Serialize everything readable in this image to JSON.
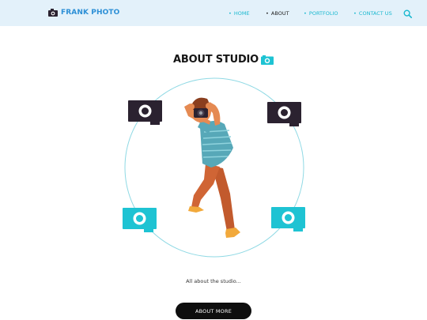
{
  "brand": {
    "name": "FRANK PHOTO",
    "icon": "camera-icon",
    "color": "#2c8fd6"
  },
  "nav": {
    "items": [
      {
        "label": "HOME",
        "active": false
      },
      {
        "label": "ABOUT",
        "active": true
      },
      {
        "label": "PORTFOLIO",
        "active": false
      },
      {
        "label": "CONTACT US",
        "active": false
      }
    ],
    "bullet": "•",
    "search_icon": "search-icon",
    "accent": "#19b8cf"
  },
  "hero": {
    "title": "ABOUT STUDIO",
    "title_icon": "camera-icon",
    "illustration": "photographer-illustration",
    "caption": "All about the studio...",
    "button_label": "ABOUT MORE"
  },
  "colors": {
    "topbar": "#e3f1fa",
    "dark_camera": "#2b2230",
    "teal_camera": "#1ec3d3",
    "circle": "#8fd9e4"
  }
}
